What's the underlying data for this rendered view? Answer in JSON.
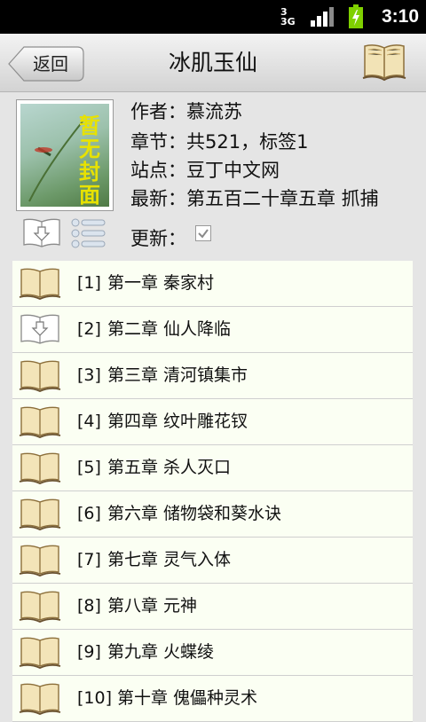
{
  "status_bar": {
    "network_label_top": "3",
    "network_label_bottom": "3G",
    "time": "3:10"
  },
  "header": {
    "back_label": "返回",
    "title": "冰肌玉仙"
  },
  "book_info": {
    "cover_text": [
      "暂",
      "无",
      "封",
      "面"
    ],
    "author_line": "作者：慕流苏",
    "chapters_line": "章节：共521，标签1",
    "site_line": "站点：豆丁中文网",
    "latest_line": "最新：第五百二十章五章 抓捕",
    "update_label": "更新：",
    "update_checked": true
  },
  "chapters": [
    {
      "num": "[1]",
      "title": "第一章 秦家村",
      "icon": "book-open-icon"
    },
    {
      "num": "[2]",
      "title": "第二章 仙人降临",
      "icon": "book-download-icon"
    },
    {
      "num": "[3]",
      "title": "第三章 清河镇集市",
      "icon": "book-open-icon"
    },
    {
      "num": "[4]",
      "title": "第四章 纹叶雕花钗",
      "icon": "book-open-icon"
    },
    {
      "num": "[5]",
      "title": "第五章 杀人灭口",
      "icon": "book-open-icon"
    },
    {
      "num": "[6]",
      "title": "第六章 储物袋和葵水诀",
      "icon": "book-open-icon"
    },
    {
      "num": "[7]",
      "title": "第七章 灵气入体",
      "icon": "book-open-icon"
    },
    {
      "num": "[8]",
      "title": "第八章 元神",
      "icon": "book-open-icon"
    },
    {
      "num": "[9]",
      "title": "第九章 火蝶绫",
      "icon": "book-open-icon"
    },
    {
      "num": "[10]",
      "title": "第十章 傀儡种灵术",
      "icon": "book-open-icon"
    }
  ]
}
